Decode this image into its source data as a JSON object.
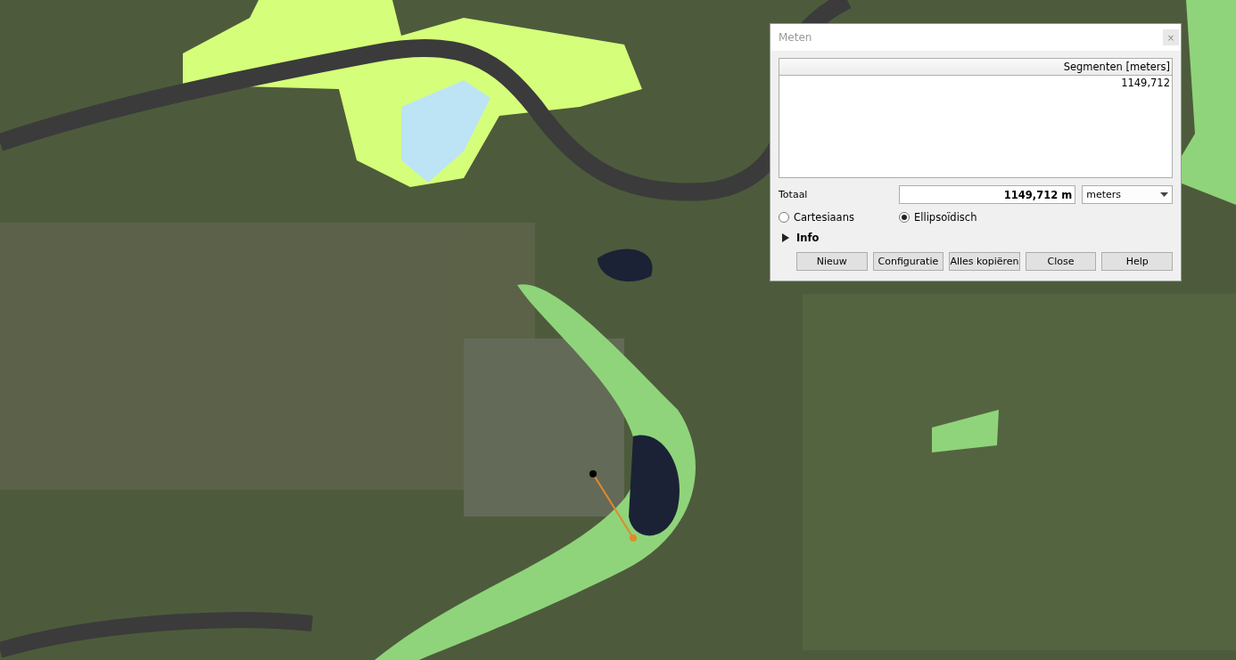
{
  "dialog": {
    "title": "Meten",
    "close_glyph": "×",
    "table": {
      "columns": [
        "Segmenten [meters]"
      ],
      "rows": [
        [
          "1149,712"
        ]
      ]
    },
    "total": {
      "label": "Totaal",
      "value": "1149,712 m",
      "unit": "meters"
    },
    "modes": [
      {
        "label": "Cartesiaans",
        "selected": false
      },
      {
        "label": "Ellipsoïdisch",
        "selected": true
      }
    ],
    "info": {
      "label": "Info",
      "expanded": false
    },
    "buttons": [
      "Nieuw",
      "Configuratie",
      "Alles kopiëren",
      "Close",
      "Help"
    ]
  }
}
